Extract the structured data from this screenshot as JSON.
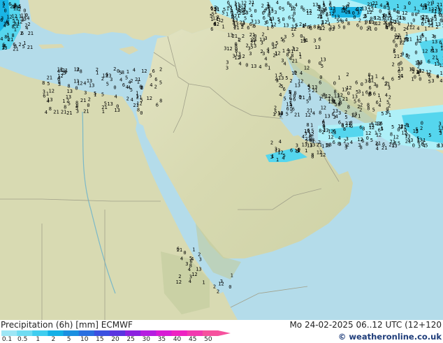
{
  "map": {
    "region": "Middle East / Arabian Peninsula",
    "colors": {
      "sea": "#b4dcea",
      "land_low": "#dfe0bd",
      "land_high": "#c6cfa5",
      "precip_light": "#aef0f8",
      "precip_mid": "#55d6ee",
      "precip_heavy": "#19b5e6"
    },
    "sample_values": [
      "0",
      "1",
      "2",
      "3",
      "4",
      "5",
      "6",
      "8",
      "12",
      "21",
      "13"
    ]
  },
  "footer": {
    "title": "Precipitation (6h) [mm] ECMWF",
    "datetime": "Mo 24-02-2025 06..12 UTC (12+120",
    "credit": "© weatheronline.co.uk"
  },
  "legend": {
    "ticks": [
      "0.1",
      "0.5",
      "1",
      "2",
      "5",
      "10",
      "15",
      "20",
      "25",
      "30",
      "35",
      "40",
      "45",
      "50"
    ],
    "colors": [
      "#9ee6f5",
      "#6fdcf2",
      "#3fcdef",
      "#13b0e6",
      "#1a8fe0",
      "#2a6fe0",
      "#3b50e0",
      "#5a34e0",
      "#8c22e0",
      "#b51ee0",
      "#d81cd5",
      "#ee22c2",
      "#f23ab0",
      "#f6529e"
    ]
  }
}
